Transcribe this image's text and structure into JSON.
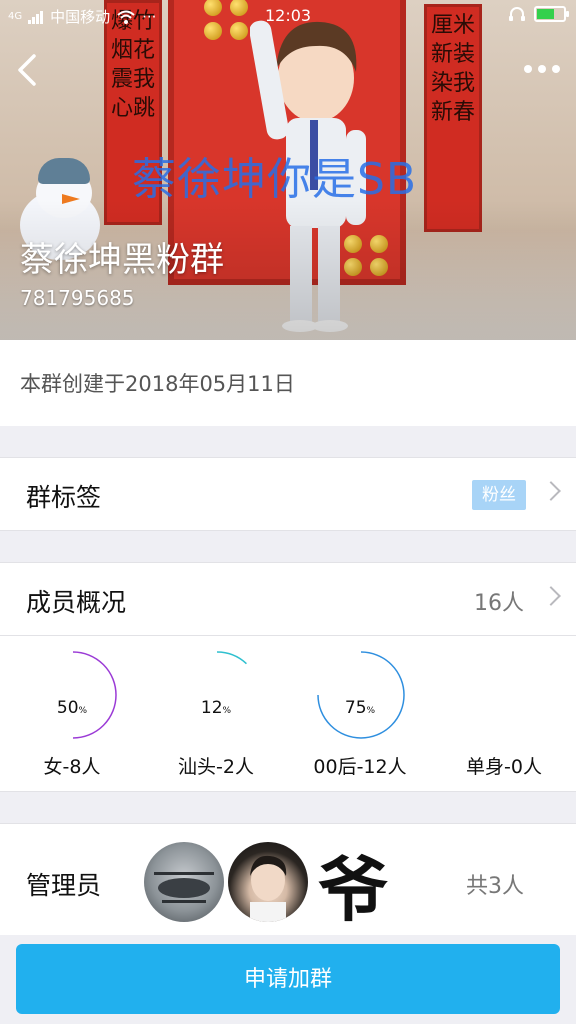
{
  "status_bar": {
    "carrier": "中国移动",
    "network": "4G",
    "time": "12:03",
    "battery_level": 0.6
  },
  "header": {
    "back_icon": "chevron-left-icon",
    "more_icon": "more-dots-icon",
    "banner_scroll_left": "爆竹烟花震我心跳",
    "banner_scroll_right": "厘米新装染我新春",
    "banner_overlay_text": "蔡徐坤你是SB",
    "group_name": "蔡徐坤黑粉群",
    "group_id": "781795685"
  },
  "created": {
    "text": "本群创建于2018年05月11日"
  },
  "tags": {
    "title": "群标签",
    "tag": "粉丝"
  },
  "members": {
    "title": "成员概况",
    "count": "16人",
    "stats": [
      {
        "percent": "50",
        "unit": "%",
        "label": "女-8人",
        "value": 0.5,
        "color": "#9b3bd6"
      },
      {
        "percent": "12",
        "unit": "%",
        "label": "汕头-2人",
        "value": 0.12,
        "color": "#2fc0cf"
      },
      {
        "percent": "75",
        "unit": "%",
        "label": "00后-12人",
        "value": 0.75,
        "color": "#2f8fdf"
      },
      {
        "percent": "",
        "unit": "",
        "label": "单身-0人",
        "value": 0,
        "color": "#cccccc"
      }
    ]
  },
  "admins": {
    "title": "管理员",
    "total": "共3人",
    "avatar3_glyph": "爷"
  },
  "actions": {
    "join_label": "申请加群"
  },
  "colors": {
    "primary": "#21b0ee",
    "tag_bg": "#a8d4f7"
  }
}
